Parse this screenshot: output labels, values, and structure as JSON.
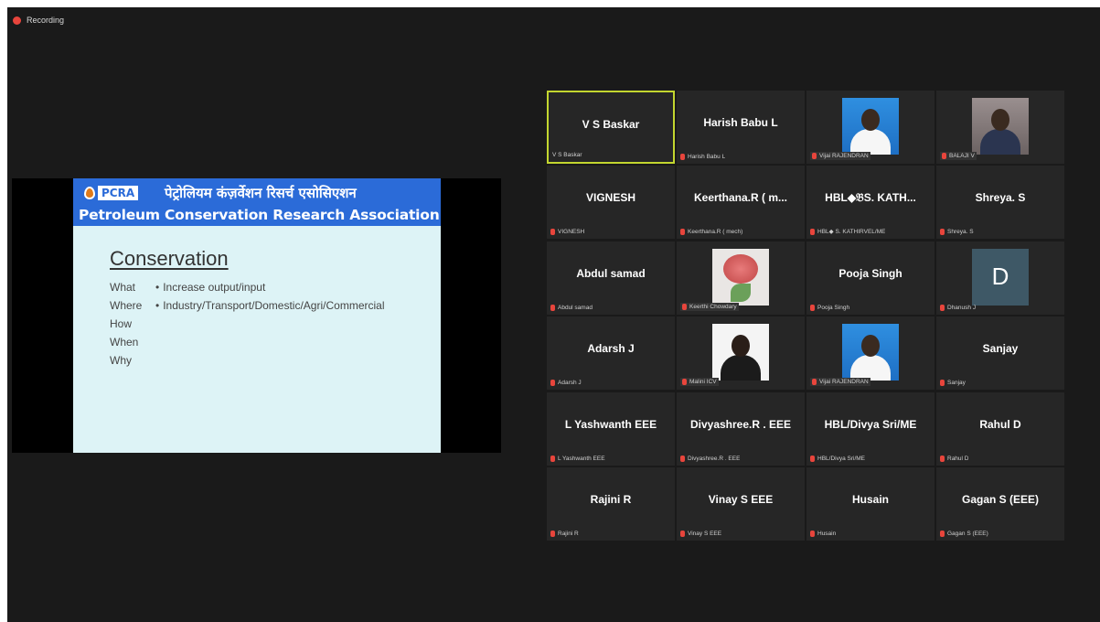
{
  "recording": {
    "label": "Recording"
  },
  "slide": {
    "logo_text": "PCRA",
    "banner_hindi": "पेट्रोलियम कंज़र्वेशन रिसर्च एसोसिएशन",
    "banner_english": "Petroleum Conservation Research Association",
    "title": "Conservation",
    "rows": [
      {
        "term": "What",
        "bullet": "•",
        "text": "Increase output/input"
      },
      {
        "term": "Where",
        "bullet": "•",
        "text": "Industry/Transport/Domestic/Agri/Commercial"
      },
      {
        "term": "How",
        "bullet": "",
        "text": ""
      },
      {
        "term": "When",
        "bullet": "",
        "text": ""
      },
      {
        "term": "Why",
        "bullet": "",
        "text": ""
      }
    ]
  },
  "participants": [
    {
      "display": "V S Baskar",
      "label": "V S Baskar",
      "video": "name",
      "active": true
    },
    {
      "display": "Harish Babu L",
      "label": "Harish Babu L",
      "video": "name"
    },
    {
      "display": "",
      "label": "Vijai RAJENDRAN",
      "video": "photo-blue"
    },
    {
      "display": "",
      "label": "BALAJI V",
      "video": "photo-grey"
    },
    {
      "display": "VIGNESH",
      "label": "VIGNESH",
      "video": "name"
    },
    {
      "display": "Keerthana.R ( m...",
      "label": "Keerthana.R ( mech)",
      "video": "name"
    },
    {
      "display": "HBL◆𝔅S. KATH...",
      "label": "HBL◆ S. KATHIRVEL/ME",
      "video": "name"
    },
    {
      "display": "Shreya. S",
      "label": "Shreya. S",
      "video": "name"
    },
    {
      "display": "Abdul samad",
      "label": "Abdul samad",
      "video": "name"
    },
    {
      "display": "",
      "label": "Keerthi Chowdary",
      "video": "photo-rose"
    },
    {
      "display": "Pooja Singh",
      "label": "Pooja Singh",
      "video": "name"
    },
    {
      "display": "D",
      "label": "Dhanush J",
      "video": "avatar"
    },
    {
      "display": "Adarsh J",
      "label": "Adarsh J",
      "video": "name"
    },
    {
      "display": "",
      "label": "Malini ICV",
      "video": "photo-white"
    },
    {
      "display": "",
      "label": "Vijai RAJENDRAN",
      "video": "photo-blue"
    },
    {
      "display": "Sanjay",
      "label": "Sanjay",
      "video": "name"
    },
    {
      "display": "L Yashwanth EEE",
      "label": "L Yashwanth EEE",
      "video": "name"
    },
    {
      "display": "Divyashree.R . EEE",
      "label": "Divyashree.R . EEE",
      "video": "name"
    },
    {
      "display": "HBL/Divya Sri/ME",
      "label": "HBL/Divya Sri/ME",
      "video": "name"
    },
    {
      "display": "Rahul D",
      "label": "Rahul D",
      "video": "name"
    },
    {
      "display": "Rajini R",
      "label": "Rajini R",
      "video": "name"
    },
    {
      "display": "Vinay S EEE",
      "label": "Vinay S EEE",
      "video": "name"
    },
    {
      "display": "Husain",
      "label": "Husain",
      "video": "name"
    },
    {
      "display": "Gagan S (EEE)",
      "label": "Gagan S (EEE)",
      "video": "name"
    }
  ]
}
